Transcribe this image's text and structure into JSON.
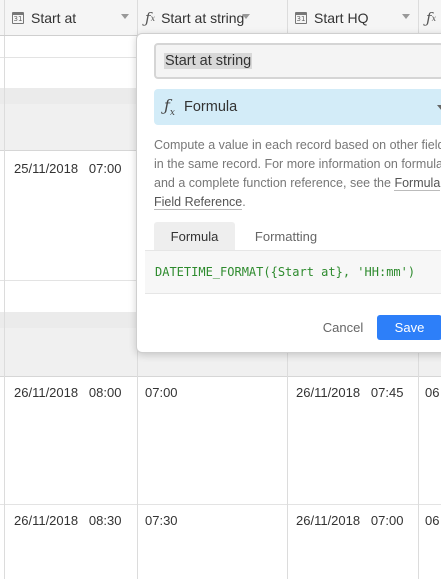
{
  "header": {
    "columns": [
      {
        "label": "Start at",
        "icon": "calendar-icon",
        "icon_text": "31"
      },
      {
        "label": "Start at string",
        "icon": "formula-icon",
        "icon_text": "fx"
      },
      {
        "label": "Start HQ",
        "icon": "calendar-icon",
        "icon_text": "31"
      },
      {
        "label": "",
        "icon": "formula-icon",
        "icon_text": "fx"
      }
    ]
  },
  "rows": [
    {
      "start_at": "25/11/2018   07:00"
    },
    {
      "start_at": "26/11/2018   08:00",
      "start_at_string": "07:00",
      "start_hq": "26/11/2018   07:45",
      "next": "06"
    },
    {
      "start_at": "26/11/2018   08:30",
      "start_at_string": "07:30",
      "start_hq": "26/11/2018   07:00",
      "next": "06"
    }
  ],
  "field_editor": {
    "field_name": "Start at string",
    "field_type": "Formula",
    "type_icon": "formula-icon",
    "description_pre": "Compute a value in each record based on other fields in the same record. For more information on formulas and a complete function reference, see the ",
    "description_link": "Formula Field Reference",
    "description_post": ".",
    "tabs": [
      "Formula",
      "Formatting"
    ],
    "formula": "DATETIME_FORMAT({Start at}, 'HH:mm')",
    "cancel_label": "Cancel",
    "save_label": "Save"
  },
  "colors": {
    "accent": "#2d7ff9",
    "type_select_bg": "#d3ecf8",
    "formula_text": "#2e8b2e"
  }
}
